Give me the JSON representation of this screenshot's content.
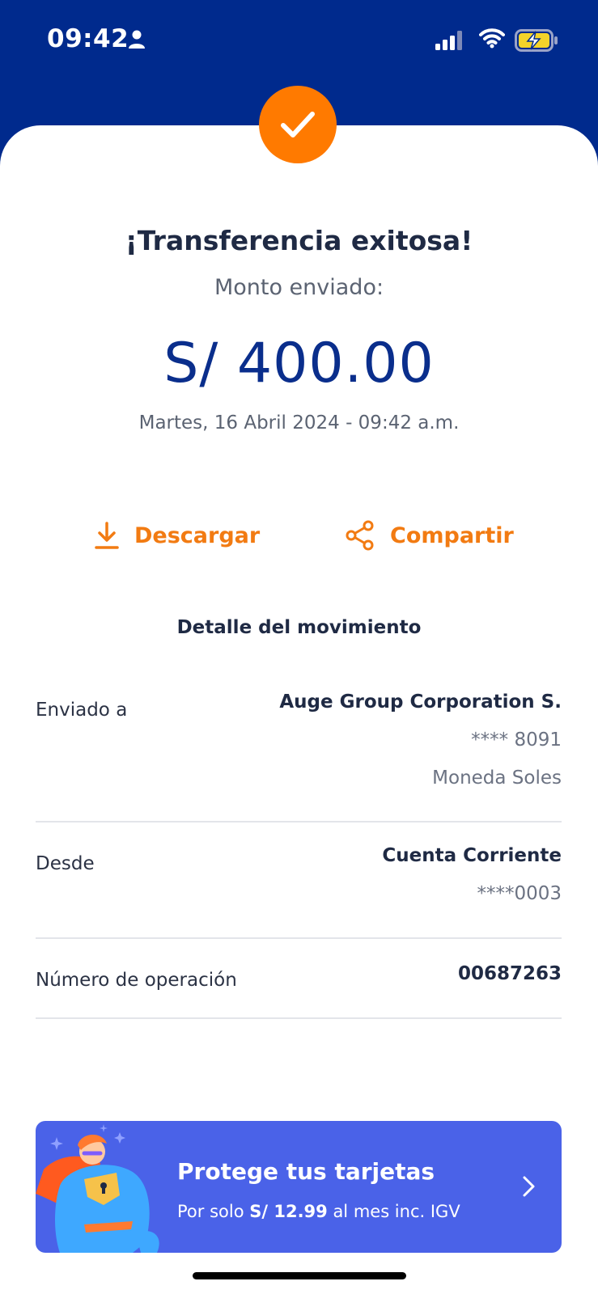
{
  "status_bar": {
    "time": "09:42",
    "icons": [
      "person-icon",
      "signal-icon",
      "wifi-icon",
      "battery-charging-icon"
    ]
  },
  "receipt": {
    "icon": "check-icon",
    "title": "¡Transferencia exitosa!",
    "subtitle": "Monto enviado:",
    "amount": "S/ 400.00",
    "datetime": "Martes, 16 Abril 2024 - 09:42 a.m."
  },
  "actions": {
    "download_label": "Descargar",
    "share_label": "Compartir"
  },
  "detail": {
    "section_title": "Detalle del movimiento",
    "rows": [
      {
        "label": "Enviado a",
        "values": [
          "Auge Group Corporation S.",
          "**** 8091",
          "Moneda Soles"
        ]
      },
      {
        "label": "Desde",
        "values": [
          "Cuenta Corriente",
          "****0003"
        ]
      },
      {
        "label": "Número de operación",
        "values": [
          "00687263"
        ]
      }
    ]
  },
  "promo": {
    "title": "Protege tus tarjetas",
    "sub_prefix": "Por solo ",
    "sub_price": "S/ 12.99",
    "sub_suffix": " al mes inc. IGV"
  },
  "colors": {
    "header_blue": "#002a8d",
    "accent_orange": "#ff7a00",
    "amount_blue": "#0a2e8c",
    "promo_blue": "#4a62e8"
  }
}
